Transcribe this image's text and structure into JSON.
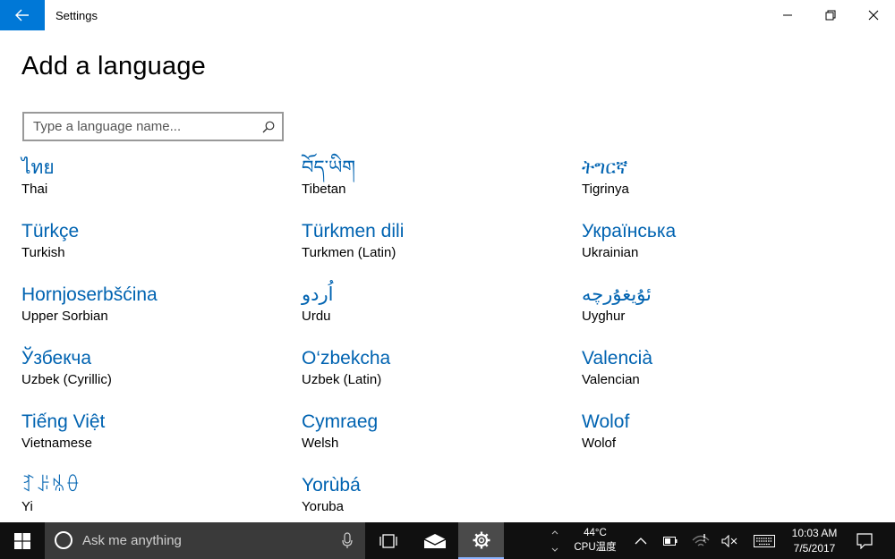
{
  "window": {
    "title": "Settings"
  },
  "page": {
    "title": "Add a language"
  },
  "search": {
    "placeholder": "Type a language name..."
  },
  "languages": [
    {
      "native": "ไทย",
      "english": "Thai"
    },
    {
      "native": "བོད་ཡིག",
      "english": "Tibetan"
    },
    {
      "native": "ትግርኛ",
      "english": "Tigrinya"
    },
    {
      "native": "Türkçe",
      "english": "Turkish"
    },
    {
      "native": "Türkmen dili",
      "english": "Turkmen (Latin)"
    },
    {
      "native": "Українська",
      "english": "Ukrainian"
    },
    {
      "native": "Hornjoserbšćina",
      "english": "Upper Sorbian"
    },
    {
      "native": "اُردو",
      "english": "Urdu"
    },
    {
      "native": "ئۇيغۇرچە",
      "english": "Uyghur"
    },
    {
      "native": "Ўзбекча",
      "english": "Uzbek (Cyrillic)"
    },
    {
      "native": "O‘zbekcha",
      "english": "Uzbek (Latin)"
    },
    {
      "native": "Valencià",
      "english": "Valencian"
    },
    {
      "native": "Tiếng Việt",
      "english": "Vietnamese"
    },
    {
      "native": "Cymraeg",
      "english": "Welsh"
    },
    {
      "native": "Wolof",
      "english": "Wolof"
    },
    {
      "native": "ꆈꌠꁱꂷ",
      "english": "Yi"
    },
    {
      "native": "Yorùbá",
      "english": "Yoruba"
    }
  ],
  "taskbar": {
    "search_placeholder": "Ask me anything",
    "temperature": "44°C",
    "temperature_label": "CPU温度",
    "time": "10:03 AM",
    "date": "7/5/2017"
  },
  "colors": {
    "accent": "#0078d7",
    "link": "#0063b1",
    "taskbar": "#101010"
  },
  "icons": {
    "back": "back-arrow-icon",
    "search": "search-icon",
    "start": "windows-logo-icon",
    "mic": "microphone-icon",
    "taskview": "task-view-icon",
    "mail": "mail-icon",
    "settings": "gear-icon",
    "battery": "battery-icon",
    "wifi": "wifi-icon",
    "volume": "volume-muted-icon",
    "keyboard": "touch-keyboard-icon",
    "notifications": "action-center-icon"
  }
}
